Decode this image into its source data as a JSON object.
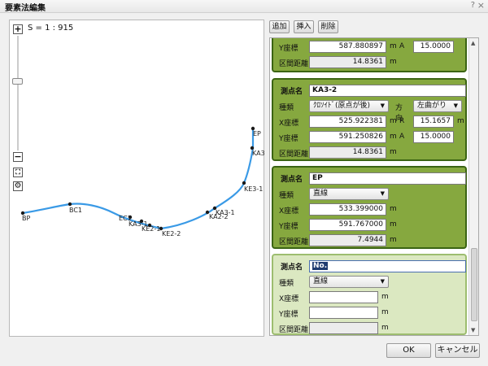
{
  "window": {
    "title": "要素法編集",
    "help": "?",
    "close": "×"
  },
  "map": {
    "scale_label": "S = 1 : 915",
    "zoom_in": "+",
    "zoom_out": "−",
    "points": [
      {
        "name": "BP"
      },
      {
        "name": "BC1"
      },
      {
        "name": "EC1"
      },
      {
        "name": "KA3-1"
      },
      {
        "name": "KE2-1"
      },
      {
        "name": "KE2-2"
      },
      {
        "name": "KA2-2"
      },
      {
        "name": "KA3-1"
      },
      {
        "name": "KE3-1"
      },
      {
        "name": "KA3"
      },
      {
        "name": "EP"
      }
    ]
  },
  "toolbar": {
    "add": "追加",
    "insert": "挿入",
    "delete": "削除"
  },
  "labels": {
    "point_name": "測点名",
    "type": "種類",
    "direction": "方向",
    "x_coord": "X座標",
    "y_coord": "Y座標",
    "section_distance": "区間距離",
    "R": "R",
    "A": "A",
    "unit_m": "m"
  },
  "cards": [
    {
      "y_value": "587.880897",
      "a_value": "15.0000",
      "distance": "14.8361"
    },
    {
      "name": "KA3-2",
      "type": "ｸﾛｿｲﾄﾞ(原点が後)",
      "direction": "左曲がり",
      "x_value": "525.922381",
      "r_value": "15.1657",
      "y_value": "591.250826",
      "a_value": "15.0000",
      "distance": "14.8361"
    },
    {
      "name": "EP",
      "type": "直線",
      "x_value": "533.399000",
      "y_value": "591.767000",
      "distance": "7.4944"
    },
    {
      "name": "No.",
      "type": "直線",
      "x_value": "",
      "y_value": "",
      "distance": ""
    }
  ],
  "footer": {
    "ok": "OK",
    "cancel": "キャンセル"
  }
}
